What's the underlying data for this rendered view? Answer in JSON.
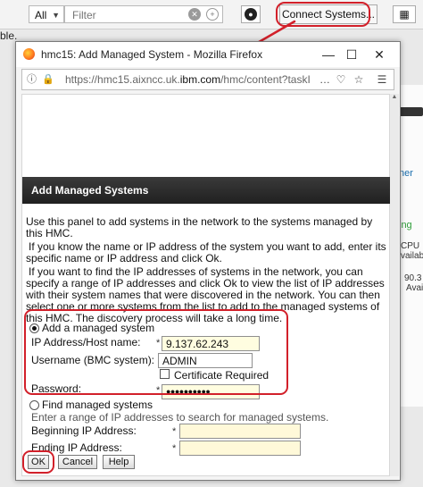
{
  "background": {
    "filter_select": "All",
    "filter_placeholder": "Filter",
    "connect_button": "Connect Systems...",
    "left_fragment": "ble.",
    "side_fragments": [
      "ner",
      "ing",
      "CPU",
      "vailab",
      "90.3",
      "Avai"
    ]
  },
  "window": {
    "title": "hmc15: Add Managed System - Mozilla Firefox",
    "url_prefix": "https://hmc15.aixncc.uk.",
    "url_domain": "ibm.com",
    "url_suffix": "/hmc/content?taskI",
    "url_overflow": "…"
  },
  "panel": {
    "title": "Add Managed Systems",
    "para1": "Use this panel to add systems in the network to the systems managed by this HMC.",
    "para2": "If you know the name or IP address of the system you want to add, enter its specific name or IP address and click Ok.",
    "para3": "If you want to find the IP addresses of systems in the network, you can specify a range of IP addresses and click Ok to view the list of IP addresses with their system names that were discovered in the network. You can then select one or more systems from the list to add to the managed systems of this HMC. The discovery process will take a long time."
  },
  "form": {
    "add_option": "Add a managed system",
    "ip_label": "IP Address/Host name:",
    "ip_value": "9.137.62.243",
    "username_label": "Username (BMC system):",
    "username_value": "ADMIN",
    "cert_label": "Certificate Required",
    "password_label": "Password:",
    "password_mask": "●●●●●●●●●●",
    "find_option": "Find managed systems",
    "find_hint": "Enter a range of IP addresses to search for managed systems.",
    "begin_label": "Beginning IP Address:",
    "end_label": "Ending IP Address:",
    "required_mark": "*"
  },
  "buttons": {
    "ok": "OK",
    "cancel": "Cancel",
    "help": "Help"
  },
  "colors": {
    "highlight": "#d2202a",
    "field_bg": "#fffde0",
    "header_bg": "#2a2a2a"
  }
}
